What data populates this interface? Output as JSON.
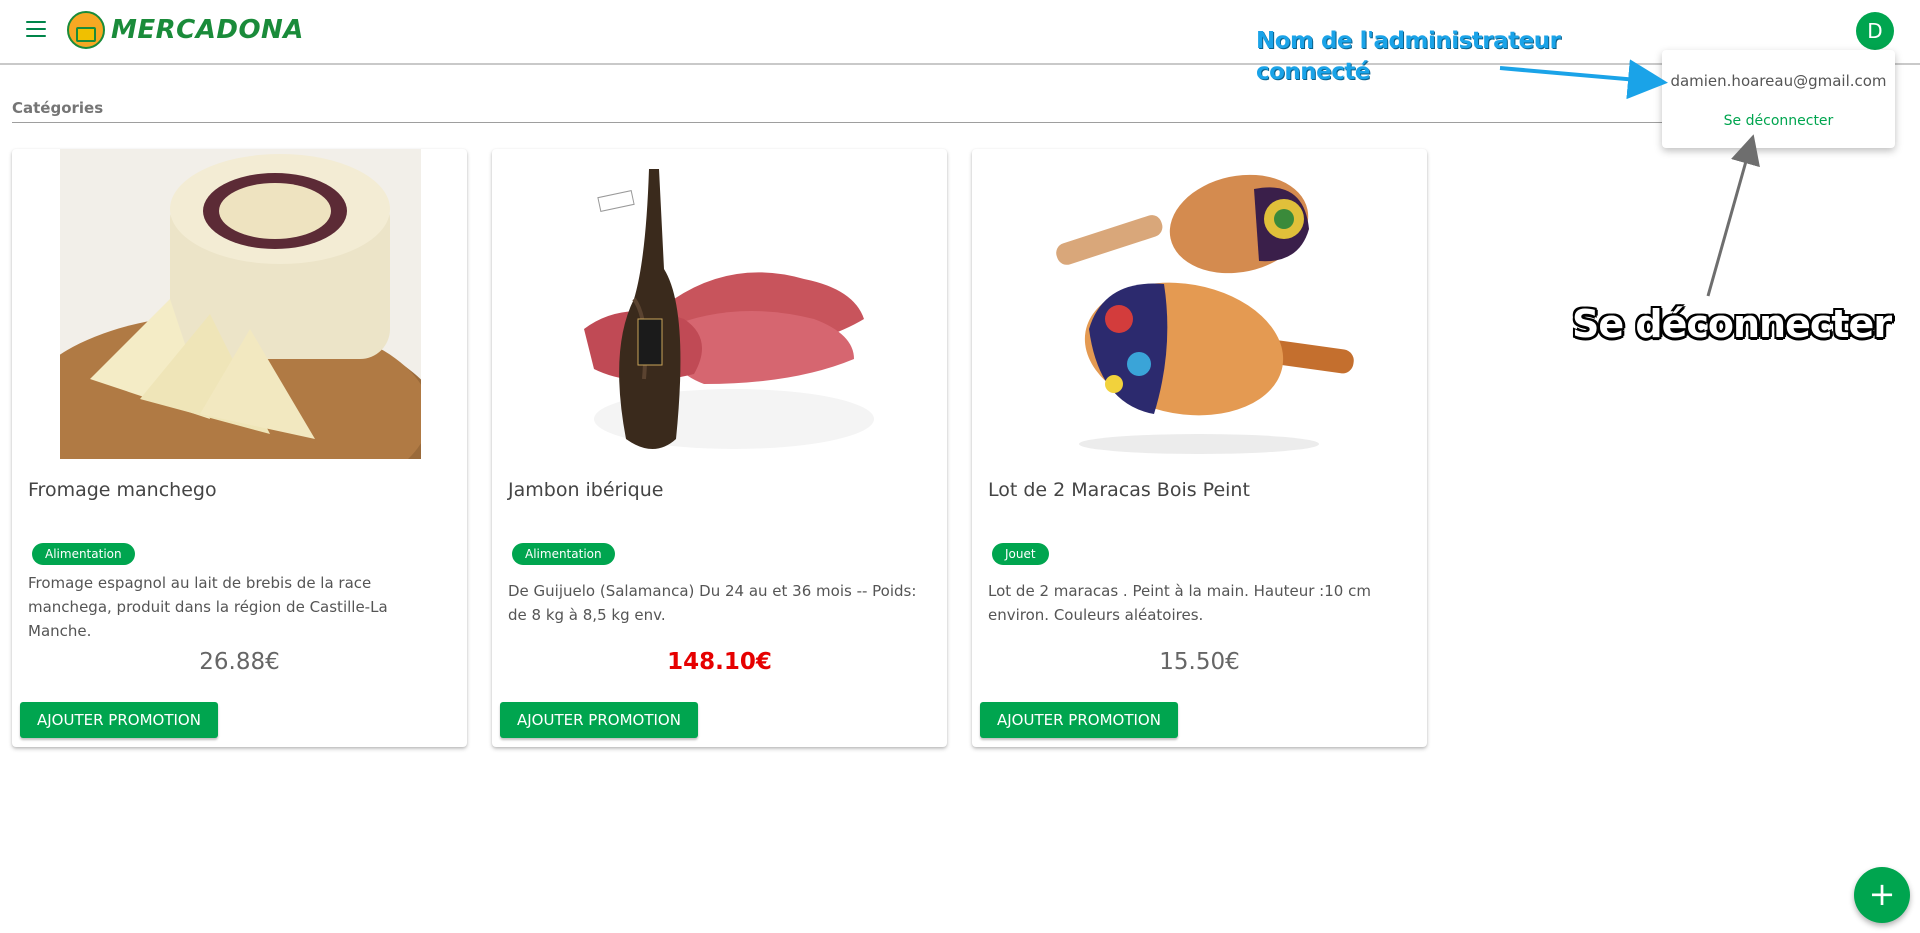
{
  "header": {
    "brand": "MERCADONA",
    "avatar_initial": "D"
  },
  "filter": {
    "label": "Catégories"
  },
  "products": [
    {
      "title": "Fromage manchego",
      "category": "Alimentation",
      "description": "Fromage espagnol au lait de brebis de la race manchega, produit dans la région de Castille-La Manche.",
      "price": "26.88€",
      "button": "AJOUTER PROMOTION"
    },
    {
      "title": "Jambon ibérique",
      "category": "Alimentation",
      "description": "De Guijuelo (Salamanca) Du 24 au et 36 mois -- Poids: de 8 kg à 8,5 kg env.",
      "price": "148.10€",
      "button": "AJOUTER PROMOTION"
    },
    {
      "title": "Lot de 2 Maracas Bois Peint",
      "category": "Jouet",
      "description": "Lot de 2 maracas . Peint à la main. Hauteur :10 cm environ. Couleurs aléatoires.",
      "price": "15.50€",
      "button": "AJOUTER PROMOTION"
    }
  ],
  "user_menu": {
    "email": "damien.hoareau@gmail.com",
    "logout": "Se déconnecter"
  },
  "annotations": {
    "admin_line1": "Nom de l'administrateur",
    "admin_line2": "connecté",
    "logout_note": "Se déconnecter"
  },
  "fab": {
    "symbol": "+"
  },
  "colors": {
    "primary": "#00a54f",
    "brand": "#1a8b3a",
    "promo_price": "#e60000",
    "annotation_blue": "#1aa3e8"
  }
}
